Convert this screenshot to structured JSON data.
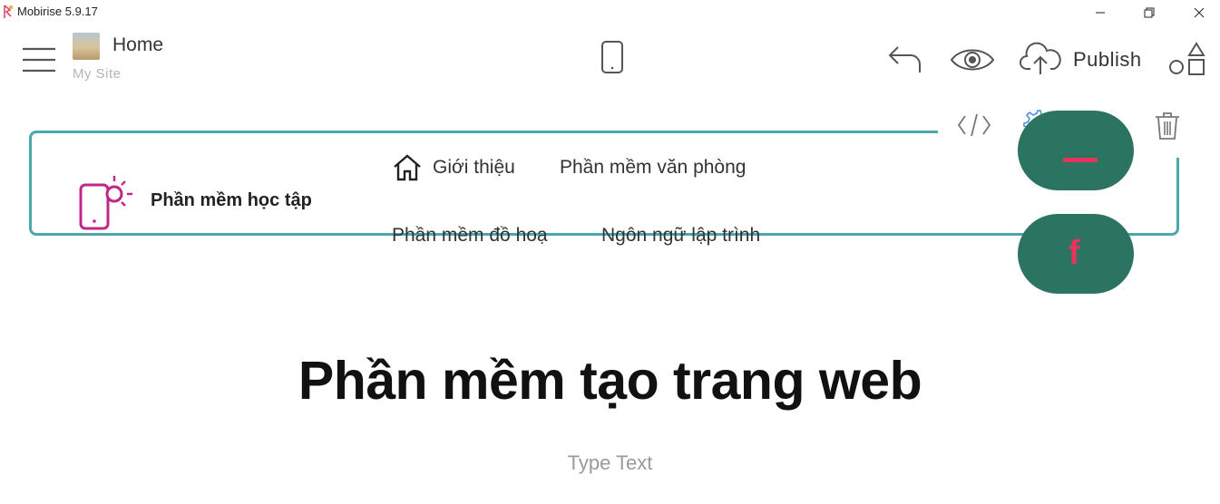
{
  "window": {
    "title": "Mobirise 5.9.17",
    "controls": [
      "minimize",
      "maximize",
      "close"
    ]
  },
  "toolbar": {
    "page_name": "Home",
    "site_name": "My Site",
    "publish_label": "Publish",
    "icons": [
      "menu-icon",
      "mobile-preview-icon",
      "undo-icon",
      "preview-eye-icon",
      "cloud-upload-icon",
      "blocks-shapes-icon"
    ]
  },
  "block_toolbar": {
    "icons": [
      "code-icon",
      "gear-icon",
      "download-icon",
      "trash-icon"
    ]
  },
  "site_nav": {
    "brand": "Phần mềm học tập",
    "items": [
      "Giới thiệu",
      "Phần mềm văn phòng",
      "Phần mềm đồ hoạ",
      "Ngôn ngữ lập trình"
    ],
    "social": [
      "facebook-icon"
    ]
  },
  "hero": {
    "title": "Phần mềm tạo trang web",
    "subtitle": "Type Text"
  },
  "colors": {
    "frame_accent": "#4aa8ad",
    "brand_pink": "#c0268a",
    "pill_green": "#2c7462",
    "facebook_red": "#e8345c"
  }
}
